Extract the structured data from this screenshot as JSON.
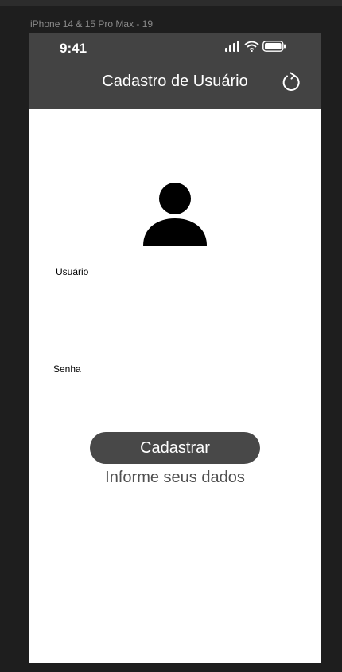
{
  "canvas": {
    "frame_label": "iPhone 14 & 15 Pro Max - 19"
  },
  "status_bar": {
    "time": "9:41",
    "icons": [
      "signal-icon",
      "wifi-icon",
      "battery-icon"
    ]
  },
  "header": {
    "title": "Cadastro de Usuário",
    "action_icon": "refresh-icon"
  },
  "form": {
    "avatar_icon": "user-icon",
    "username_label": "Usuário",
    "username_value": "",
    "password_label": "Senha",
    "password_value": "",
    "submit_label": "Cadastrar",
    "hint": "Informe seus dados"
  },
  "colors": {
    "header_bg": "#434343",
    "button_bg": "#484848",
    "canvas_bg": "#1e1e1e"
  }
}
